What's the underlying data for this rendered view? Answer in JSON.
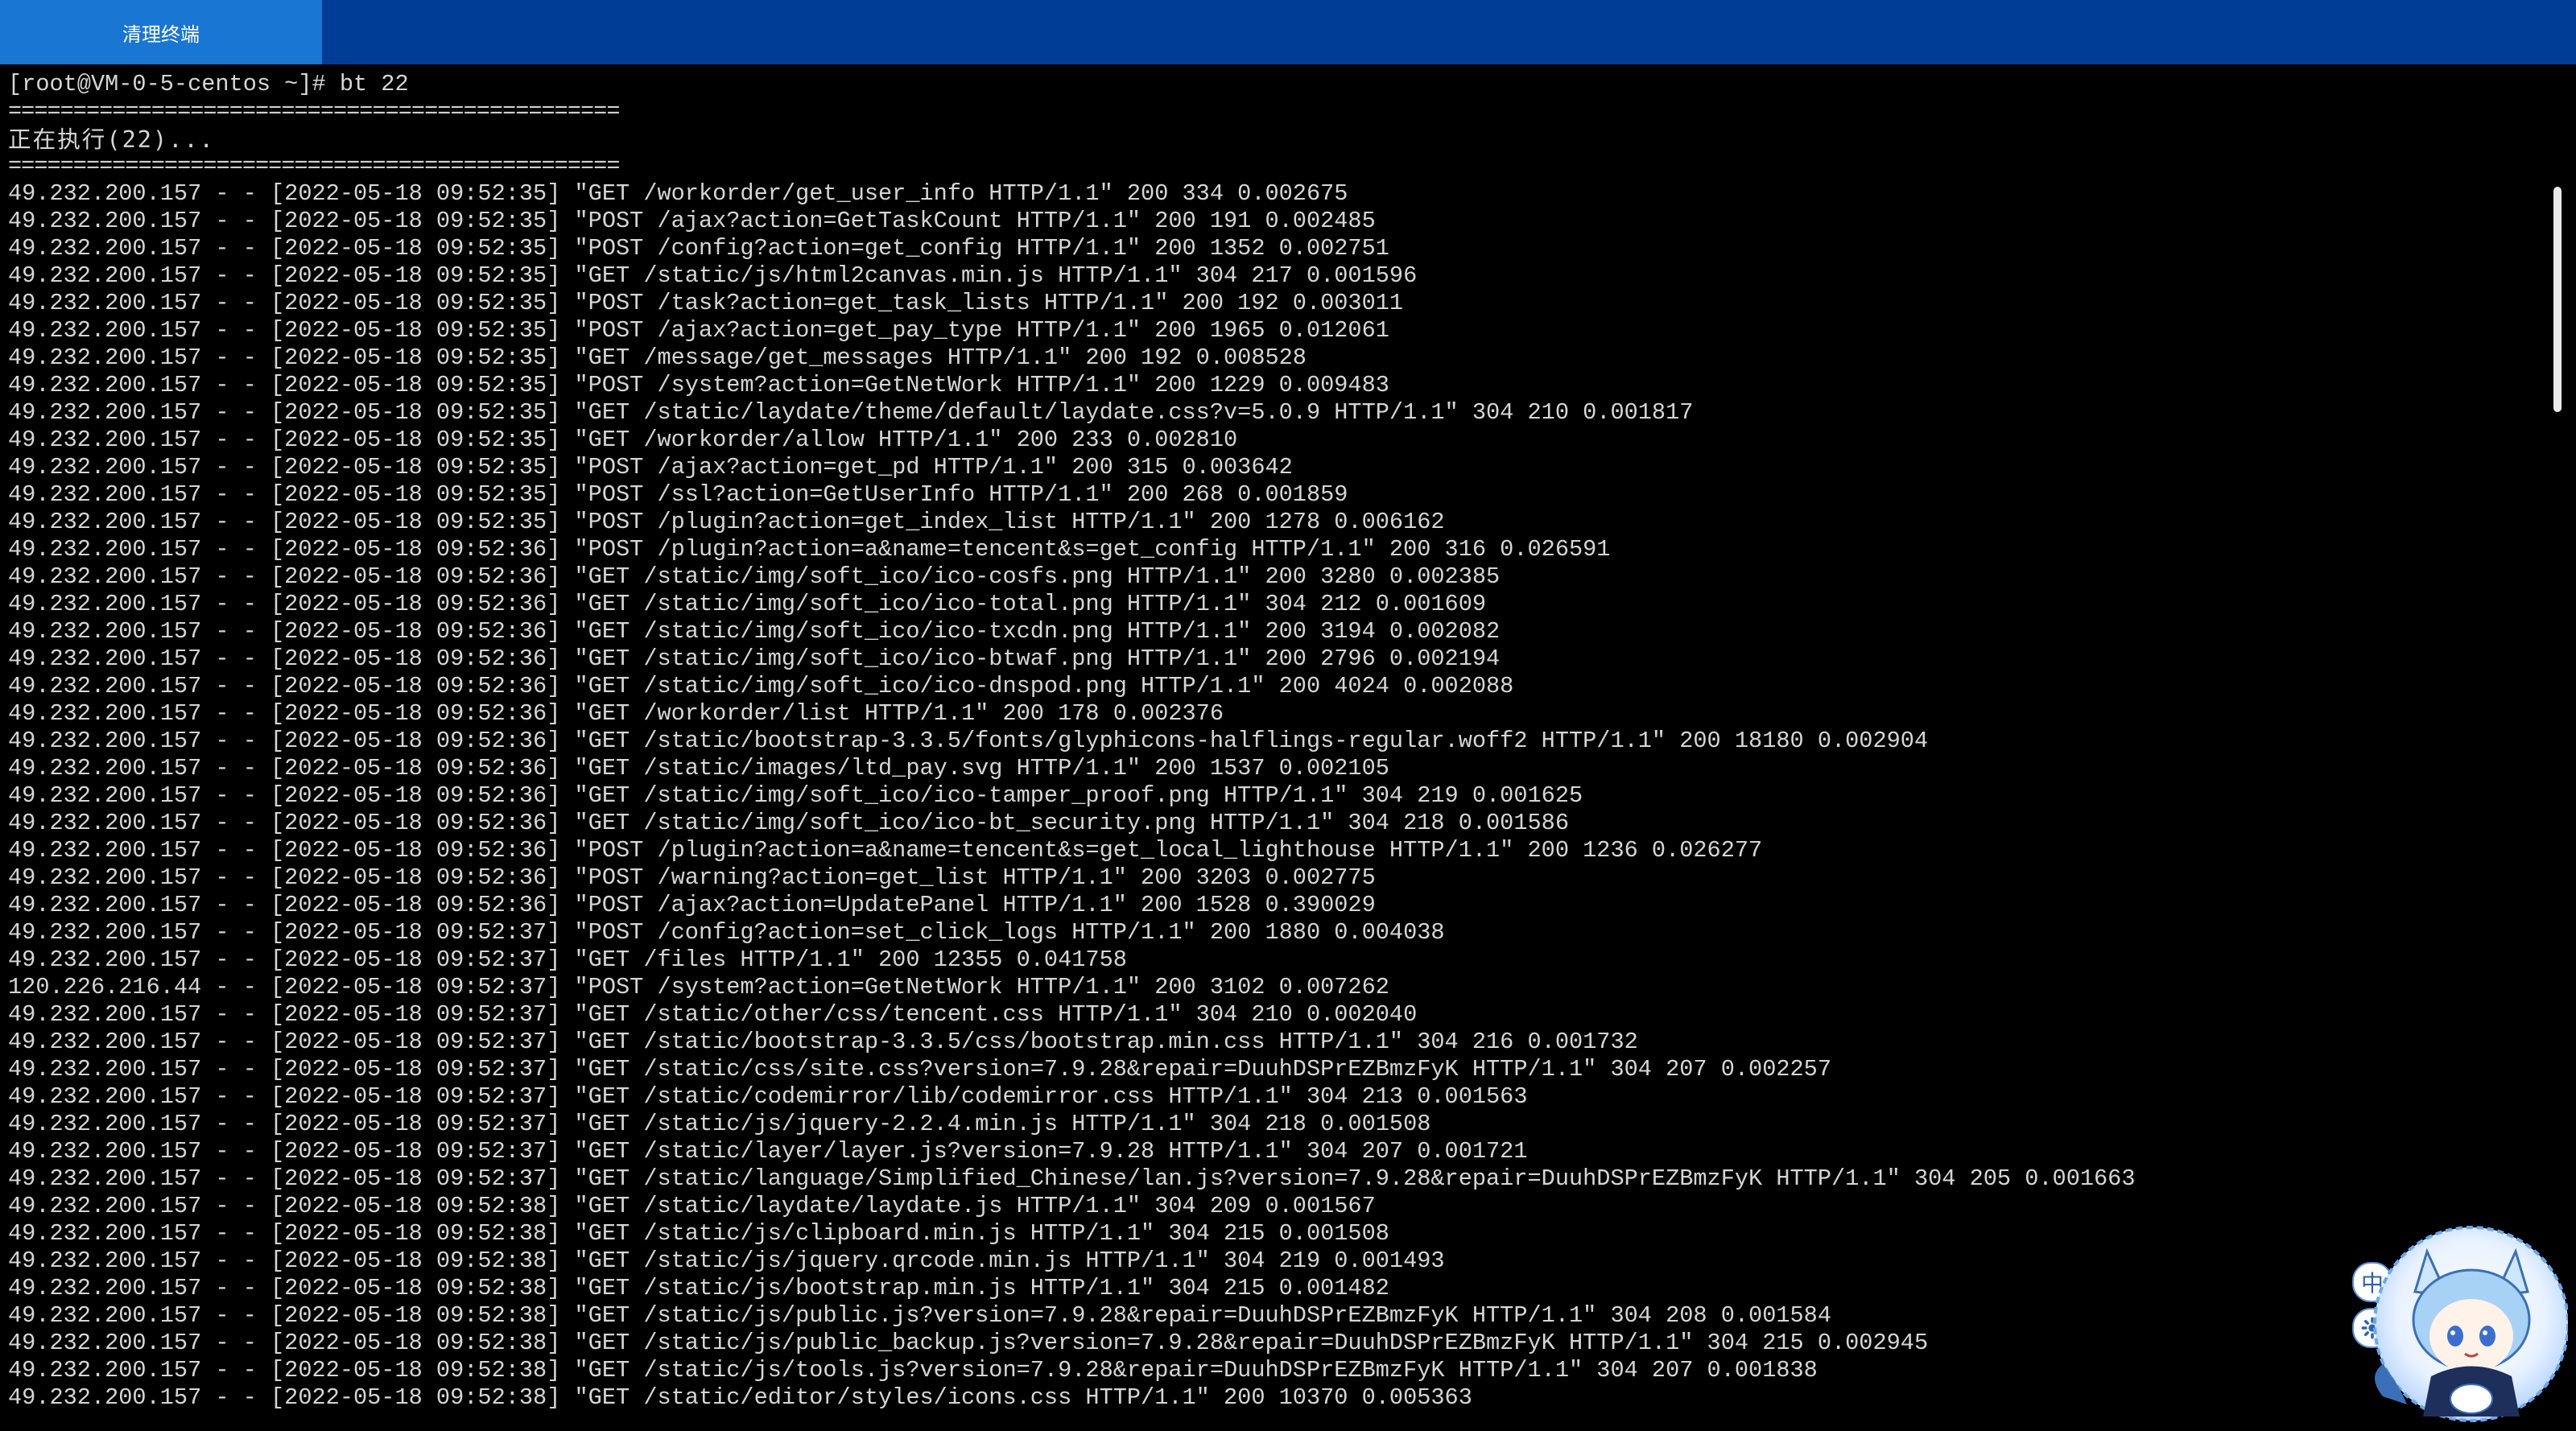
{
  "tab": {
    "label": "清理终端"
  },
  "terminal": {
    "prompt_line": "[root@VM-0-5-centos ~]# bt 22",
    "separator": "===============================================",
    "status_line": "正在执行(22)...",
    "log_lines": [
      "49.232.200.157 - - [2022-05-18 09:52:35] \"GET /workorder/get_user_info HTTP/1.1\" 200 334 0.002675",
      "49.232.200.157 - - [2022-05-18 09:52:35] \"POST /ajax?action=GetTaskCount HTTP/1.1\" 200 191 0.002485",
      "49.232.200.157 - - [2022-05-18 09:52:35] \"POST /config?action=get_config HTTP/1.1\" 200 1352 0.002751",
      "49.232.200.157 - - [2022-05-18 09:52:35] \"GET /static/js/html2canvas.min.js HTTP/1.1\" 304 217 0.001596",
      "49.232.200.157 - - [2022-05-18 09:52:35] \"POST /task?action=get_task_lists HTTP/1.1\" 200 192 0.003011",
      "49.232.200.157 - - [2022-05-18 09:52:35] \"POST /ajax?action=get_pay_type HTTP/1.1\" 200 1965 0.012061",
      "49.232.200.157 - - [2022-05-18 09:52:35] \"GET /message/get_messages HTTP/1.1\" 200 192 0.008528",
      "49.232.200.157 - - [2022-05-18 09:52:35] \"POST /system?action=GetNetWork HTTP/1.1\" 200 1229 0.009483",
      "49.232.200.157 - - [2022-05-18 09:52:35] \"GET /static/laydate/theme/default/laydate.css?v=5.0.9 HTTP/1.1\" 304 210 0.001817",
      "49.232.200.157 - - [2022-05-18 09:52:35] \"GET /workorder/allow HTTP/1.1\" 200 233 0.002810",
      "49.232.200.157 - - [2022-05-18 09:52:35] \"POST /ajax?action=get_pd HTTP/1.1\" 200 315 0.003642",
      "49.232.200.157 - - [2022-05-18 09:52:35] \"POST /ssl?action=GetUserInfo HTTP/1.1\" 200 268 0.001859",
      "49.232.200.157 - - [2022-05-18 09:52:35] \"POST /plugin?action=get_index_list HTTP/1.1\" 200 1278 0.006162",
      "49.232.200.157 - - [2022-05-18 09:52:36] \"POST /plugin?action=a&name=tencent&s=get_config HTTP/1.1\" 200 316 0.026591",
      "49.232.200.157 - - [2022-05-18 09:52:36] \"GET /static/img/soft_ico/ico-cosfs.png HTTP/1.1\" 200 3280 0.002385",
      "49.232.200.157 - - [2022-05-18 09:52:36] \"GET /static/img/soft_ico/ico-total.png HTTP/1.1\" 304 212 0.001609",
      "49.232.200.157 - - [2022-05-18 09:52:36] \"GET /static/img/soft_ico/ico-txcdn.png HTTP/1.1\" 200 3194 0.002082",
      "49.232.200.157 - - [2022-05-18 09:52:36] \"GET /static/img/soft_ico/ico-btwaf.png HTTP/1.1\" 200 2796 0.002194",
      "49.232.200.157 - - [2022-05-18 09:52:36] \"GET /static/img/soft_ico/ico-dnspod.png HTTP/1.1\" 200 4024 0.002088",
      "49.232.200.157 - - [2022-05-18 09:52:36] \"GET /workorder/list HTTP/1.1\" 200 178 0.002376",
      "49.232.200.157 - - [2022-05-18 09:52:36] \"GET /static/bootstrap-3.3.5/fonts/glyphicons-halflings-regular.woff2 HTTP/1.1\" 200 18180 0.002904",
      "49.232.200.157 - - [2022-05-18 09:52:36] \"GET /static/images/ltd_pay.svg HTTP/1.1\" 200 1537 0.002105",
      "49.232.200.157 - - [2022-05-18 09:52:36] \"GET /static/img/soft_ico/ico-tamper_proof.png HTTP/1.1\" 304 219 0.001625",
      "49.232.200.157 - - [2022-05-18 09:52:36] \"GET /static/img/soft_ico/ico-bt_security.png HTTP/1.1\" 304 218 0.001586",
      "49.232.200.157 - - [2022-05-18 09:52:36] \"POST /plugin?action=a&name=tencent&s=get_local_lighthouse HTTP/1.1\" 200 1236 0.026277",
      "49.232.200.157 - - [2022-05-18 09:52:36] \"POST /warning?action=get_list HTTP/1.1\" 200 3203 0.002775",
      "49.232.200.157 - - [2022-05-18 09:52:36] \"POST /ajax?action=UpdatePanel HTTP/1.1\" 200 1528 0.390029",
      "49.232.200.157 - - [2022-05-18 09:52:37] \"POST /config?action=set_click_logs HTTP/1.1\" 200 1880 0.004038",
      "49.232.200.157 - - [2022-05-18 09:52:37] \"GET /files HTTP/1.1\" 200 12355 0.041758",
      "120.226.216.44 - - [2022-05-18 09:52:37] \"POST /system?action=GetNetWork HTTP/1.1\" 200 3102 0.007262",
      "49.232.200.157 - - [2022-05-18 09:52:37] \"GET /static/other/css/tencent.css HTTP/1.1\" 304 210 0.002040",
      "49.232.200.157 - - [2022-05-18 09:52:37] \"GET /static/bootstrap-3.3.5/css/bootstrap.min.css HTTP/1.1\" 304 216 0.001732",
      "49.232.200.157 - - [2022-05-18 09:52:37] \"GET /static/css/site.css?version=7.9.28&repair=DuuhDSPrEZBmzFyK HTTP/1.1\" 304 207 0.002257",
      "49.232.200.157 - - [2022-05-18 09:52:37] \"GET /static/codemirror/lib/codemirror.css HTTP/1.1\" 304 213 0.001563",
      "49.232.200.157 - - [2022-05-18 09:52:37] \"GET /static/js/jquery-2.2.4.min.js HTTP/1.1\" 304 218 0.001508",
      "49.232.200.157 - - [2022-05-18 09:52:37] \"GET /static/layer/layer.js?version=7.9.28 HTTP/1.1\" 304 207 0.001721",
      "49.232.200.157 - - [2022-05-18 09:52:37] \"GET /static/language/Simplified_Chinese/lan.js?version=7.9.28&repair=DuuhDSPrEZBmzFyK HTTP/1.1\" 304 205 0.001663",
      "49.232.200.157 - - [2022-05-18 09:52:38] \"GET /static/laydate/laydate.js HTTP/1.1\" 304 209 0.001567",
      "49.232.200.157 - - [2022-05-18 09:52:38] \"GET /static/js/clipboard.min.js HTTP/1.1\" 304 215 0.001508",
      "49.232.200.157 - - [2022-05-18 09:52:38] \"GET /static/js/jquery.qrcode.min.js HTTP/1.1\" 304 219 0.001493",
      "49.232.200.157 - - [2022-05-18 09:52:38] \"GET /static/js/bootstrap.min.js HTTP/1.1\" 304 215 0.001482",
      "49.232.200.157 - - [2022-05-18 09:52:38] \"GET /static/js/public.js?version=7.9.28&repair=DuuhDSPrEZBmzFyK HTTP/1.1\" 304 208 0.001584",
      "49.232.200.157 - - [2022-05-18 09:52:38] \"GET /static/js/public_backup.js?version=7.9.28&repair=DuuhDSPrEZBmzFyK HTTP/1.1\" 304 215 0.002945",
      "49.232.200.157 - - [2022-05-18 09:52:38] \"GET /static/js/tools.js?version=7.9.28&repair=DuuhDSPrEZBmzFyK HTTP/1.1\" 304 207 0.001838",
      "49.232.200.157 - - [2022-05-18 09:52:38] \"GET /static/editor/styles/icons.css HTTP/1.1\" 200 10370 0.005363"
    ]
  },
  "ime": {
    "mode_label": "中"
  },
  "icons": {
    "ime_mode": "chinese-mode-icon",
    "ime_settings": "gear-icon",
    "mascot": "anime-cat-ear-mascot"
  },
  "colors": {
    "header_bg": "#003d96",
    "tab_active_bg": "#1976d2",
    "terminal_bg": "#000000",
    "terminal_fg": "#d6d6d6"
  }
}
